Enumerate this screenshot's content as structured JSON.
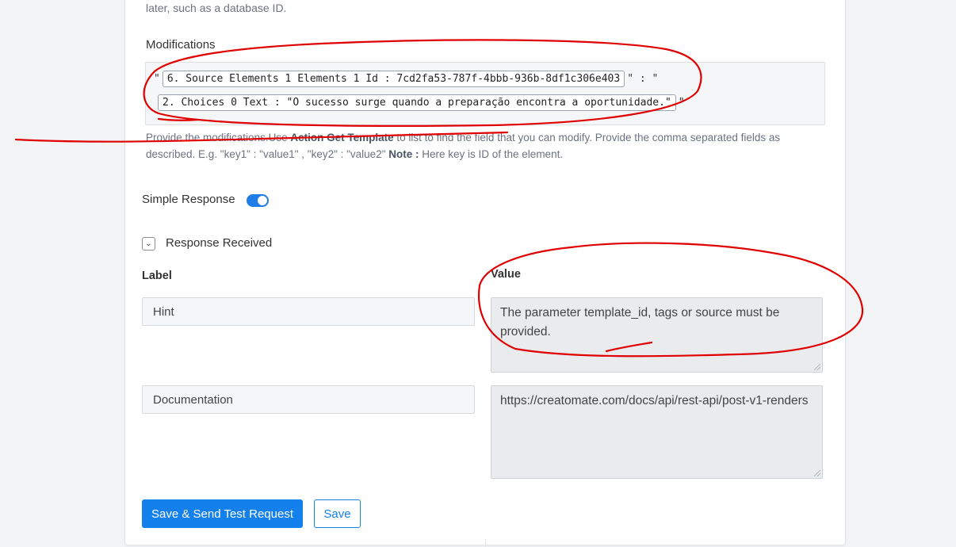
{
  "top_help": "later, such as a database ID.",
  "modifications": {
    "label": "Modifications",
    "line1": {
      "prefix": "\"",
      "chip": "6. Source Elements 1 Elements 1 Id : 7cd2fa53-787f-4bbb-936b-8df1c306e403",
      "suffix": "\" : \""
    },
    "line2": {
      "prefix": "",
      "chip": "2. Choices 0 Text : \"O sucesso surge quando a preparação encontra a oportunidade.\"",
      "suffix": "\""
    },
    "help_prefix": "Provide the modifications.Use ",
    "help_action": "Action Get Template",
    "help_middle": " to list to find the field that you can modify. Provide the comma separated fields as described. E.g. \"key1\" : \"value1\" , \"key2\" : \"value2\" ",
    "help_note": "Note :",
    "help_suffix": " Here key is ID of the element."
  },
  "simple_response": {
    "label": "Simple Response",
    "enabled": true
  },
  "response_received": {
    "label": "Response Received",
    "chevron": "chevron-down-icon"
  },
  "table": {
    "label_header": "Label",
    "value_header": "Value",
    "rows": [
      {
        "label": "Hint",
        "value": "The parameter template_id, tags or source must be provided."
      },
      {
        "label": "Documentation",
        "value": "https://creatomate.com/docs/api/rest-api/post-v1-renders"
      }
    ]
  },
  "buttons": {
    "save_send": "Save & Send Test Request",
    "save": "Save"
  },
  "colors": {
    "primary": "#1380ec",
    "toggle": "#1e7de6",
    "annotation": "#e00000"
  }
}
